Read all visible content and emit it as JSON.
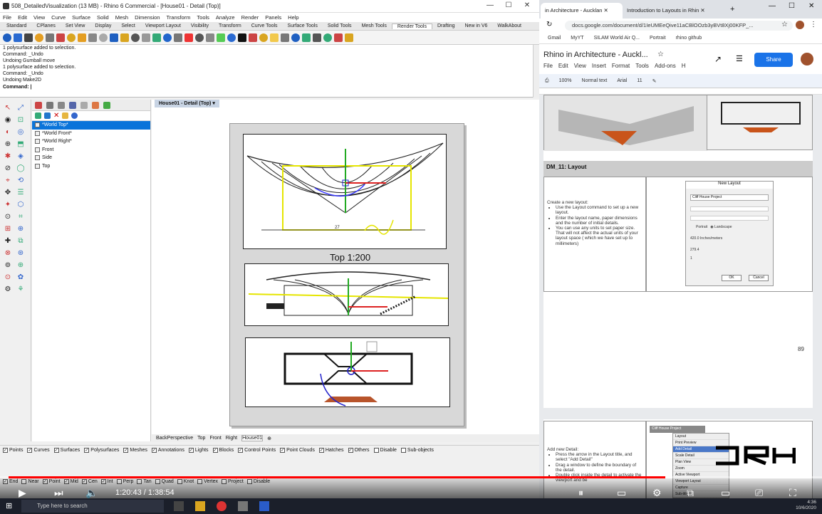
{
  "rhino": {
    "title": "508_DetailedVisualization (13 MB) - Rhino 6 Commercial - [House01 - Detail (Top)]",
    "menu": [
      "File",
      "Edit",
      "View",
      "Curve",
      "Surface",
      "Solid",
      "Mesh",
      "Dimension",
      "Transform",
      "Tools",
      "Analyze",
      "Render",
      "Panels",
      "Help"
    ],
    "tabs": [
      "Standard",
      "CPlanes",
      "Set View",
      "Display",
      "Select",
      "Viewport Layout",
      "Visibility",
      "Transform",
      "Curve Tools",
      "Surface Tools",
      "Solid Tools",
      "Mesh Tools",
      "Render Tools",
      "Drafting",
      "New in V6",
      "WalkAbout"
    ],
    "active_tab": "Render Tools",
    "command_history": [
      "1 polysurface added to selection.",
      "Command: _Undo",
      "Undoing Gumball move",
      "1 polysurface added to selection.",
      "Command: _Undo",
      "Undoing Make2D"
    ],
    "command_prompt": "Command:",
    "layers": [
      "*World Top*",
      "*World Front*",
      "*World Right*",
      "Front",
      "Side",
      "Top"
    ],
    "viewport_title": "House01 - Detail (Top)",
    "detail_label": "Top 1:200",
    "dimension_text": "27",
    "layout_tabs": [
      "BackPerspective",
      "Top",
      "Front",
      "Right",
      "House01"
    ],
    "active_layout": "House01",
    "selection_filters": [
      {
        "label": "Points",
        "on": true
      },
      {
        "label": "Curves",
        "on": true
      },
      {
        "label": "Surfaces",
        "on": true
      },
      {
        "label": "Polysurfaces",
        "on": true
      },
      {
        "label": "Meshes",
        "on": true
      },
      {
        "label": "Annotations",
        "on": true
      },
      {
        "label": "Lights",
        "on": true
      },
      {
        "label": "Blocks",
        "on": true
      },
      {
        "label": "Control Points",
        "on": true
      },
      {
        "label": "Point Clouds",
        "on": true
      },
      {
        "label": "Hatches",
        "on": true
      },
      {
        "label": "Others",
        "on": true
      },
      {
        "label": "Disable",
        "on": false
      },
      {
        "label": "Sub-objects",
        "on": false
      }
    ],
    "osnaps": [
      {
        "label": "End",
        "on": true
      },
      {
        "label": "Near",
        "on": false
      },
      {
        "label": "Point",
        "on": true
      },
      {
        "label": "Mid",
        "on": true
      },
      {
        "label": "Cen",
        "on": true
      },
      {
        "label": "Int",
        "on": true
      },
      {
        "label": "Perp",
        "on": false
      },
      {
        "label": "Tan",
        "on": false
      },
      {
        "label": "Quad",
        "on": false
      },
      {
        "label": "Knot",
        "on": false
      },
      {
        "label": "Vertex",
        "on": false
      },
      {
        "label": "Project",
        "on": false
      },
      {
        "label": "Disable",
        "on": false
      }
    ]
  },
  "chrome": {
    "tabs": [
      "in Architecture - Aucklan",
      "Introduction to Layouts in Rhin"
    ],
    "url": "docs.google.com/document/d/1IeUMEeQive11aCBlOOzb3yBVt8Xj00KFP_...",
    "bookmarks": [
      "Gmail",
      "MyYT",
      "SILAM World Air Q...",
      "Portrait",
      "rhino github"
    ],
    "new_tab": "+"
  },
  "gdoc": {
    "title": "Rhino in Architecture - Auckl...",
    "menu": [
      "File",
      "Edit",
      "View",
      "Insert",
      "Format",
      "Tools",
      "Add-ons",
      "H"
    ],
    "share": "Share",
    "toolbar": {
      "zoom": "100%",
      "style": "Normal text",
      "font": "Arial",
      "size": "11"
    },
    "section_title": "DM_11: Layout",
    "intro": "Create a new layout:",
    "bullets": [
      "Use the Layout command to set up a new layout.",
      "Enter the layout name, paper dimensions and the number of initial details.",
      "You can use any units to set paper size. That will not affect the actual units of your layout space ( which we have set up to millimeters)"
    ],
    "page_number": "89",
    "intro2": "Add new Detail:",
    "bullets2": [
      "Press the arrow in the Layout title, and select \"Add Detail\"",
      "Drag a window to define the boundary of the detail.",
      "Double click inside the detail to activate the viewport and be"
    ],
    "dialog": {
      "title": "New Layout",
      "name": "Cliff House Project",
      "ok": "OK",
      "cancel": "Cancel",
      "units": "Inches/meters",
      "width": "420.0",
      "height": "279.4",
      "details": "1",
      "orient_p": "Portrait",
      "orient_l": "Landscape"
    },
    "menu_popup": [
      "Layout",
      "Print Preview",
      "Add Detail",
      "Scale Detail",
      "Plan View",
      "Zoom",
      "Active Viewport",
      "Viewport Layout",
      "Capture",
      "Sub-title"
    ],
    "popup_header": "Cliff House Project"
  },
  "youtube": {
    "current_time": "1:20:43",
    "duration": "1:38:54",
    "progress": 0.816
  },
  "taskbar": {
    "search": "Type here to search",
    "time": "4:36",
    "date": "10/6/2020"
  },
  "overlay_logo": "DRH",
  "colors": {
    "rhino_sel": "#0a74da",
    "share": "#1a73e8",
    "yt_red": "#ff0000"
  }
}
